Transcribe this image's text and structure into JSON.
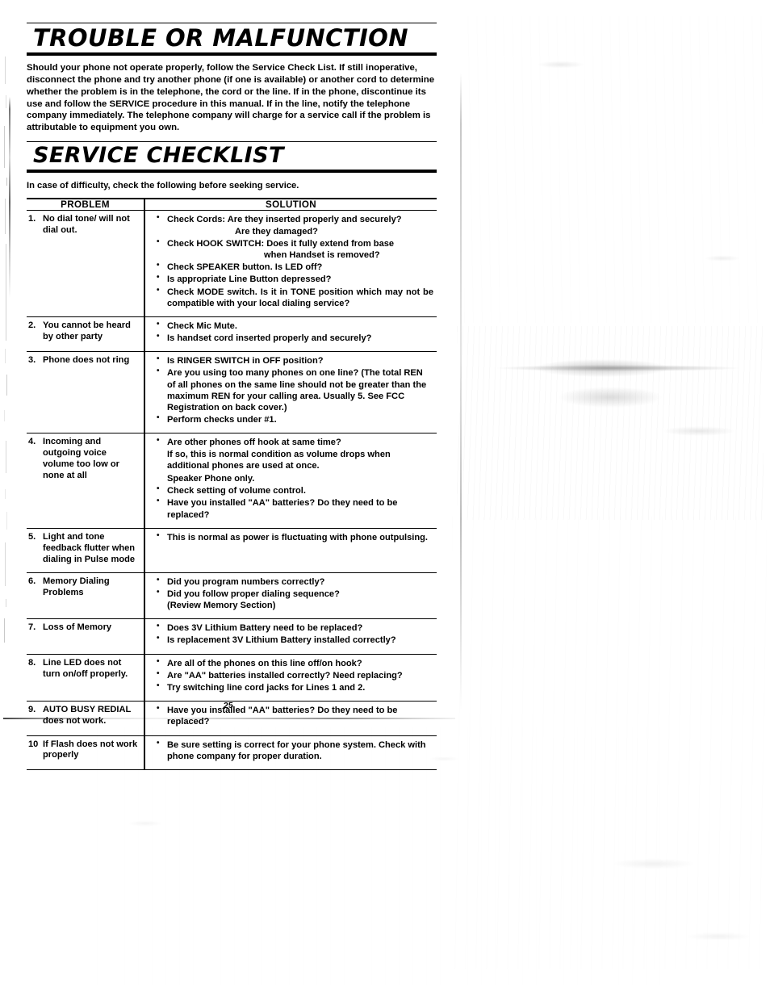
{
  "document": {
    "page_number": "25"
  },
  "section_trouble": {
    "title": "TROUBLE OR MALFUNCTION",
    "body": "Should your phone not operate properly, follow the Service Check List. If still inoperative, disconnect the phone and try another phone (if one is available) or another cord to determine whether the problem is in the telephone, the cord or the line. If in the phone, discontinue its use and follow the SERVICE procedure in this manual. If in the line, notify the telephone company immediately. The telephone company will charge for a service call if the problem is attributable to equipment you own."
  },
  "section_checklist": {
    "title": "SERVICE CHECKLIST",
    "intro": "In case of difficulty, check the following before seeking service.",
    "columns": {
      "problem": "PROBLEM",
      "solution": "SOLUTION"
    },
    "rows": [
      {
        "num": "1.",
        "problem": "No dial tone/ will not dial out.",
        "problem_lines": [
          "No dial tone/",
          "will not dial out."
        ],
        "solutions": [
          "Check Cords:  Are they inserted properly and securely?",
          "Are they damaged?",
          "Check HOOK SWITCH:  Does it fully extend from base",
          "when Handset is removed?",
          "Check SPEAKER button. Is LED off?",
          "Is appropriate Line Button depressed?",
          "Check MODE switch. Is it in TONE position which may not be compatible with your local dialing service?"
        ]
      },
      {
        "num": "2.",
        "problem": "You cannot be heard by other party",
        "problem_lines": [
          "You cannot be heard by",
          "other party"
        ],
        "solutions": [
          "Check Mic Mute.",
          "Is handset cord inserted properly and securely?"
        ]
      },
      {
        "num": "3.",
        "problem": "Phone does not ring",
        "problem_lines": [
          "Phone does not ring"
        ],
        "solutions": [
          "Is RINGER SWITCH in OFF position?",
          "Are you using too many phones on one line? (The total REN of all phones on the same line should not be greater than the maximum REN for your calling area. Usually 5. See FCC Registration on back cover.)",
          "Perform checks under #1."
        ]
      },
      {
        "num": "4.",
        "problem": "Incoming and outgoing voice volume too low or none at all",
        "problem_lines": [
          "Incoming and outgoing",
          "voice volume too low or",
          "none at all"
        ],
        "solutions": [
          "Are other phones off hook at same time?",
          "If so, this is normal condition as volume drops when additional phones are used at once.",
          "Speaker Phone only.",
          "Check setting of volume control.",
          "Have you installed \"AA\" batteries? Do they need to be replaced?"
        ]
      },
      {
        "num": "5.",
        "problem": "Light and tone feedback flutter when dialing in Pulse mode",
        "problem_lines": [
          "Light and tone feedback",
          "flutter when dialing in",
          "Pulse mode"
        ],
        "solutions": [
          "This is normal as power is fluctuating with phone outpulsing."
        ]
      },
      {
        "num": "6.",
        "problem": "Memory Dialing Problems",
        "problem_lines": [
          "Memory Dialing",
          "Problems"
        ],
        "solutions": [
          "Did you program numbers correctly?",
          "Did you follow proper dialing sequence?",
          "(Review Memory Section)"
        ]
      },
      {
        "num": "7.",
        "problem": "Loss of Memory",
        "problem_lines": [
          "Loss of Memory"
        ],
        "solutions": [
          "Does 3V Lithium Battery need to be replaced?",
          "Is replacement 3V Lithium Battery installed correctly?"
        ]
      },
      {
        "num": "8.",
        "problem": "Line LED does not turn on/off properly.",
        "problem_lines": [
          "Line LED does not turn",
          "on/off properly."
        ],
        "solutions": [
          "Are all of the phones on this line off/on hook?",
          "Are \"AA\" batteries installed correctly? Need replacing?",
          "Try switching line cord jacks for Lines 1 and 2."
        ]
      },
      {
        "num": "9.",
        "problem": "AUTO BUSY REDIAL does not work.",
        "problem_lines": [
          "AUTO BUSY REDIAL",
          "does not work."
        ],
        "solutions": [
          "Have you installed \"AA\" batteries? Do they need to be replaced?"
        ]
      },
      {
        "num": "10",
        "problem": "If Flash does not work properly",
        "problem_lines": [
          "If Flash does not work",
          "properly"
        ],
        "solutions": [
          "Be sure setting is correct for your phone system. Check with phone company for proper duration."
        ]
      }
    ]
  }
}
